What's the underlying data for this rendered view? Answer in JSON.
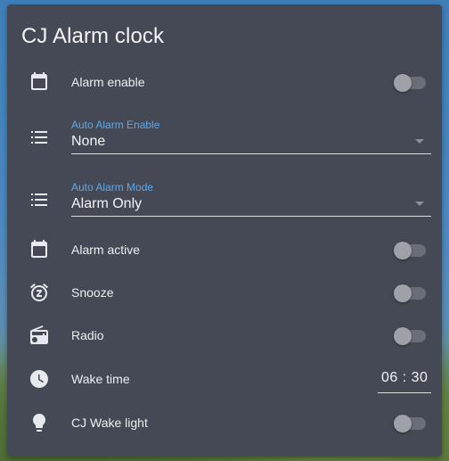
{
  "card": {
    "title": "CJ Alarm clock"
  },
  "rows": {
    "alarm_enable": {
      "label": "Alarm enable",
      "icon": "calendar-icon",
      "state": "off"
    },
    "auto_alarm_enable": {
      "label": "Auto Alarm Enable",
      "value": "None",
      "icon": "list-icon"
    },
    "auto_alarm_mode": {
      "label": "Auto Alarm Mode",
      "value": "Alarm Only",
      "icon": "list-icon"
    },
    "alarm_active": {
      "label": "Alarm active",
      "icon": "calendar-icon",
      "state": "off"
    },
    "snooze": {
      "label": "Snooze",
      "icon": "alarm-snooze-icon",
      "state": "off"
    },
    "radio": {
      "label": "Radio",
      "icon": "radio-icon",
      "state": "off"
    },
    "wake_time": {
      "label": "Wake time",
      "value": "06 : 30",
      "icon": "clock-icon"
    },
    "wake_light": {
      "label": "CJ Wake light",
      "icon": "lightbulb-icon",
      "state": "off"
    }
  },
  "colors": {
    "card_bg": "#444955",
    "accent": "#5fa8e8",
    "toggle_track": "#6a6e77",
    "toggle_thumb": "#9ea1a7"
  }
}
